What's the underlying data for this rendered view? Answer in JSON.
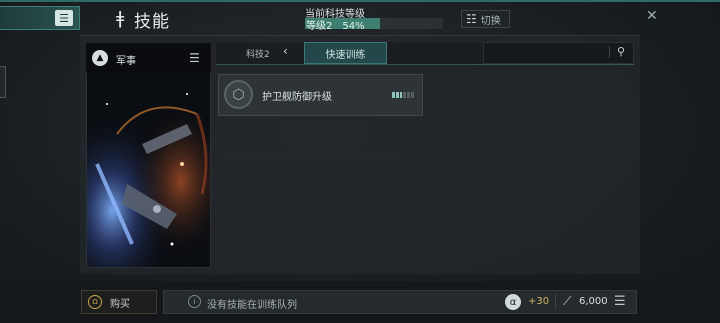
{
  "header": {
    "title_icon": "dna-icon",
    "title": "技能",
    "tech_label": "当前科技等级",
    "tech_level": "等级2",
    "tech_percent": "54%",
    "tech_progress": 0.54,
    "switch_label": "切换"
  },
  "card": {
    "title": "军事"
  },
  "tabs": {
    "breadcrumb": "科技2",
    "active": "快速训练"
  },
  "skills": [
    {
      "label": "护卫舰防御升级",
      "progress_segments": 6,
      "progress_done": 3
    }
  ],
  "footer": {
    "buy_label": "购买",
    "queue_text": "没有技能在训练队列",
    "bonus_value": "+30",
    "resource_value": "6,000"
  },
  "colors": {
    "accent": "#3e7f72",
    "gold": "#d4b463"
  }
}
